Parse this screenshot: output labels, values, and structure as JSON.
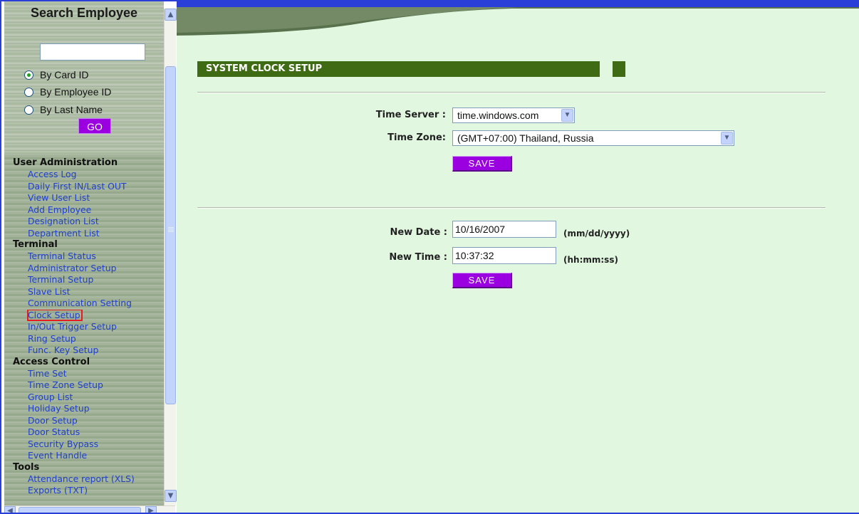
{
  "sidebar": {
    "search_title": "Search Employee",
    "search_value": "",
    "radios": [
      {
        "label": "By Card ID",
        "checked": true
      },
      {
        "label": "By Employee ID",
        "checked": false
      },
      {
        "label": "By Last Name",
        "checked": false
      }
    ],
    "go_label": "GO",
    "sections": [
      {
        "title": "User Administration",
        "items": [
          "Access Log",
          "Daily First IN/Last OUT",
          "View User List",
          "Add Employee",
          "Designation List",
          "Department List"
        ]
      },
      {
        "title": "Terminal",
        "items": [
          "Terminal Status",
          "Administrator Setup",
          "Terminal Setup",
          "Slave List",
          "Communication Setting",
          "Clock Setup",
          "In/Out Trigger Setup",
          "Ring Setup",
          "Func. Key Setup"
        ]
      },
      {
        "title": "Access Control",
        "items": [
          "Time Set",
          "Time Zone Setup",
          "Group List",
          "Holiday Setup",
          "Door Setup",
          "Door Status",
          "Security Bypass",
          "Event Handle"
        ]
      },
      {
        "title": "Tools",
        "items": [
          "Attendance report (XLS)",
          "Exports (TXT)"
        ]
      }
    ],
    "selected_item": "Clock Setup"
  },
  "main": {
    "section_title": "SYSTEM CLOCK SETUP",
    "server_form": {
      "time_server_label": "Time Server :",
      "time_server_value": "time.windows.com",
      "time_zone_label": "Time Zone:",
      "time_zone_value": "(GMT+07:00) Thailand, Russia",
      "save_label": "SAVE"
    },
    "date_form": {
      "new_date_label": "New Date :",
      "new_date_value": "10/16/2007",
      "new_date_hint": "(mm/dd/yyyy)",
      "new_time_label": "New Time :",
      "new_time_value": "10:37:32",
      "new_time_hint": "(hh:mm:ss)",
      "save_label": "SAVE"
    }
  },
  "icons": {
    "scroll_up": "chevron-up-icon",
    "scroll_down": "chevron-down-icon",
    "scroll_left": "chevron-left-icon",
    "scroll_right": "chevron-right-icon",
    "dropdown": "chevron-down-icon"
  },
  "colors": {
    "section_bar": "#3e6b14",
    "save_button": "#9b00e0",
    "main_background": "#e1f7e0",
    "link": "#1f3fd0",
    "selection_outline": "#e41e1e"
  }
}
